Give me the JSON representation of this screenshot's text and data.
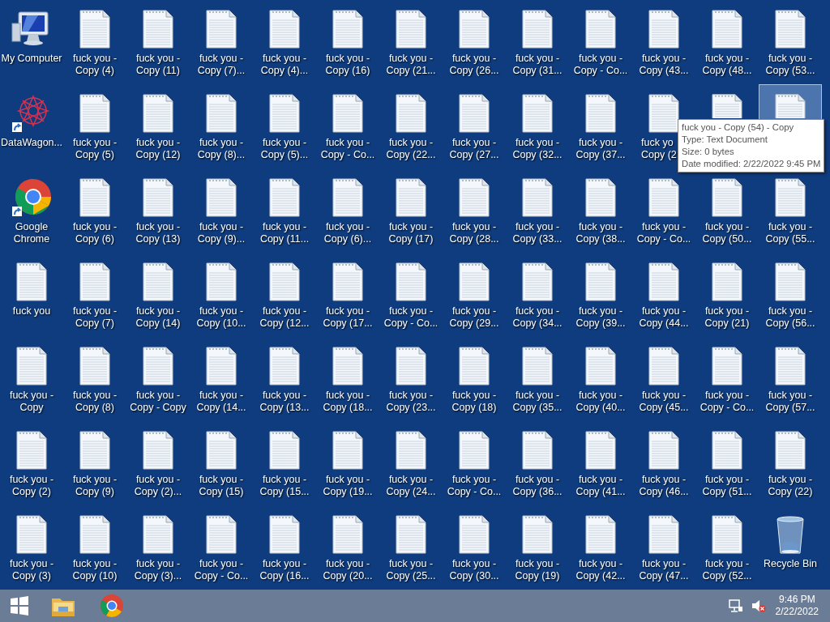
{
  "desktop_rows": [
    [
      {
        "kind": "computer",
        "lines": [
          "My Computer"
        ],
        "selected": false
      },
      {
        "kind": "text",
        "lines": [
          "fuck you -",
          "Copy (4)"
        ],
        "selected": false
      },
      {
        "kind": "text",
        "lines": [
          "fuck you -",
          "Copy (11)"
        ],
        "selected": false
      },
      {
        "kind": "text",
        "lines": [
          "fuck you -",
          "Copy (7)..."
        ],
        "selected": false
      },
      {
        "kind": "text",
        "lines": [
          "fuck you -",
          "Copy (4)..."
        ],
        "selected": false
      },
      {
        "kind": "text",
        "lines": [
          "fuck you -",
          "Copy (16)"
        ],
        "selected": false
      },
      {
        "kind": "text",
        "lines": [
          "fuck you -",
          "Copy (21..."
        ],
        "selected": false
      },
      {
        "kind": "text",
        "lines": [
          "fuck you -",
          "Copy (26..."
        ],
        "selected": false
      },
      {
        "kind": "text",
        "lines": [
          "fuck you -",
          "Copy (31..."
        ],
        "selected": false
      },
      {
        "kind": "text",
        "lines": [
          "fuck you -",
          "Copy - Co..."
        ],
        "selected": false
      },
      {
        "kind": "text",
        "lines": [
          "fuck you -",
          "Copy (43..."
        ],
        "selected": false
      },
      {
        "kind": "text",
        "lines": [
          "fuck you -",
          "Copy (48..."
        ],
        "selected": false
      },
      {
        "kind": "text",
        "lines": [
          "fuck you -",
          "Copy (53..."
        ],
        "selected": false
      }
    ],
    [
      {
        "kind": "app",
        "lines": [
          "DataWagon..."
        ],
        "selected": false
      },
      {
        "kind": "text",
        "lines": [
          "fuck you -",
          "Copy (5)"
        ],
        "selected": false
      },
      {
        "kind": "text",
        "lines": [
          "fuck you -",
          "Copy (12)"
        ],
        "selected": false
      },
      {
        "kind": "text",
        "lines": [
          "fuck you -",
          "Copy (8)..."
        ],
        "selected": false
      },
      {
        "kind": "text",
        "lines": [
          "fuck you -",
          "Copy (5)..."
        ],
        "selected": false
      },
      {
        "kind": "text",
        "lines": [
          "fuck you -",
          "Copy - Co..."
        ],
        "selected": false
      },
      {
        "kind": "text",
        "lines": [
          "fuck you -",
          "Copy (22..."
        ],
        "selected": false
      },
      {
        "kind": "text",
        "lines": [
          "fuck you -",
          "Copy (27..."
        ],
        "selected": false
      },
      {
        "kind": "text",
        "lines": [
          "fuck you -",
          "Copy (32..."
        ],
        "selected": false
      },
      {
        "kind": "text",
        "lines": [
          "fuck you -",
          "Copy (37..."
        ],
        "selected": false
      },
      {
        "kind": "text",
        "lines": [
          "fuck yo",
          "Copy (2"
        ],
        "selected": false
      },
      {
        "kind": "text",
        "selected": false
      },
      {
        "kind": "text",
        "selected": true
      }
    ],
    [
      {
        "kind": "chrome",
        "lines": [
          "Google",
          "Chrome"
        ],
        "selected": false
      },
      {
        "kind": "text",
        "lines": [
          "fuck you -",
          "Copy (6)"
        ],
        "selected": false
      },
      {
        "kind": "text",
        "lines": [
          "fuck you -",
          "Copy (13)"
        ],
        "selected": false
      },
      {
        "kind": "text",
        "lines": [
          "fuck you -",
          "Copy (9)..."
        ],
        "selected": false
      },
      {
        "kind": "text",
        "lines": [
          "fuck you -",
          "Copy (11..."
        ],
        "selected": false
      },
      {
        "kind": "text",
        "lines": [
          "fuck you -",
          "Copy (6)..."
        ],
        "selected": false
      },
      {
        "kind": "text",
        "lines": [
          "fuck you -",
          "Copy (17)"
        ],
        "selected": false
      },
      {
        "kind": "text",
        "lines": [
          "fuck you -",
          "Copy (28..."
        ],
        "selected": false
      },
      {
        "kind": "text",
        "lines": [
          "fuck you -",
          "Copy (33..."
        ],
        "selected": false
      },
      {
        "kind": "text",
        "lines": [
          "fuck you -",
          "Copy (38..."
        ],
        "selected": false
      },
      {
        "kind": "text",
        "lines": [
          "fuck you -",
          "Copy - Co..."
        ],
        "selected": false
      },
      {
        "kind": "text",
        "lines": [
          "fuck you -",
          "Copy (50..."
        ],
        "selected": false
      },
      {
        "kind": "text",
        "lines": [
          "fuck you -",
          "Copy (55..."
        ],
        "selected": false
      }
    ],
    [
      {
        "kind": "text",
        "lines": [
          "fuck you"
        ],
        "selected": false
      },
      {
        "kind": "text",
        "lines": [
          "fuck you -",
          "Copy (7)"
        ],
        "selected": false
      },
      {
        "kind": "text",
        "lines": [
          "fuck you -",
          "Copy (14)"
        ],
        "selected": false
      },
      {
        "kind": "text",
        "lines": [
          "fuck you -",
          "Copy (10..."
        ],
        "selected": false
      },
      {
        "kind": "text",
        "lines": [
          "fuck you -",
          "Copy (12..."
        ],
        "selected": false
      },
      {
        "kind": "text",
        "lines": [
          "fuck you -",
          "Copy (17..."
        ],
        "selected": false
      },
      {
        "kind": "text",
        "lines": [
          "fuck you -",
          "Copy - Co..."
        ],
        "selected": false
      },
      {
        "kind": "text",
        "lines": [
          "fuck you -",
          "Copy (29..."
        ],
        "selected": false
      },
      {
        "kind": "text",
        "lines": [
          "fuck you -",
          "Copy (34..."
        ],
        "selected": false
      },
      {
        "kind": "text",
        "lines": [
          "fuck you -",
          "Copy (39..."
        ],
        "selected": false
      },
      {
        "kind": "text",
        "lines": [
          "fuck you -",
          "Copy (44..."
        ],
        "selected": false
      },
      {
        "kind": "text",
        "lines": [
          "fuck you -",
          "Copy (21)"
        ],
        "selected": false
      },
      {
        "kind": "text",
        "lines": [
          "fuck you -",
          "Copy (56..."
        ],
        "selected": false
      }
    ],
    [
      {
        "kind": "text",
        "lines": [
          "fuck you -",
          "Copy"
        ],
        "selected": false
      },
      {
        "kind": "text",
        "lines": [
          "fuck you -",
          "Copy (8)"
        ],
        "selected": false
      },
      {
        "kind": "text",
        "lines": [
          "fuck you -",
          "Copy - Copy"
        ],
        "selected": false
      },
      {
        "kind": "text",
        "lines": [
          "fuck you -",
          "Copy (14..."
        ],
        "selected": false
      },
      {
        "kind": "text",
        "lines": [
          "fuck you -",
          "Copy (13..."
        ],
        "selected": false
      },
      {
        "kind": "text",
        "lines": [
          "fuck you -",
          "Copy (18..."
        ],
        "selected": false
      },
      {
        "kind": "text",
        "lines": [
          "fuck you -",
          "Copy (23..."
        ],
        "selected": false
      },
      {
        "kind": "text",
        "lines": [
          "fuck you -",
          "Copy (18)"
        ],
        "selected": false
      },
      {
        "kind": "text",
        "lines": [
          "fuck you -",
          "Copy (35..."
        ],
        "selected": false
      },
      {
        "kind": "text",
        "lines": [
          "fuck you -",
          "Copy (40..."
        ],
        "selected": false
      },
      {
        "kind": "text",
        "lines": [
          "fuck you -",
          "Copy (45..."
        ],
        "selected": false
      },
      {
        "kind": "text",
        "lines": [
          "fuck you -",
          "Copy - Co..."
        ],
        "selected": false
      },
      {
        "kind": "text",
        "lines": [
          "fuck you -",
          "Copy (57..."
        ],
        "selected": false
      }
    ],
    [
      {
        "kind": "text",
        "lines": [
          "fuck you -",
          "Copy (2)"
        ],
        "selected": false
      },
      {
        "kind": "text",
        "lines": [
          "fuck you -",
          "Copy (9)"
        ],
        "selected": false
      },
      {
        "kind": "text",
        "lines": [
          "fuck you -",
          "Copy (2)..."
        ],
        "selected": false
      },
      {
        "kind": "text",
        "lines": [
          "fuck you -",
          "Copy (15)"
        ],
        "selected": false
      },
      {
        "kind": "text",
        "lines": [
          "fuck you -",
          "Copy (15..."
        ],
        "selected": false
      },
      {
        "kind": "text",
        "lines": [
          "fuck you -",
          "Copy (19..."
        ],
        "selected": false
      },
      {
        "kind": "text",
        "lines": [
          "fuck you -",
          "Copy (24..."
        ],
        "selected": false
      },
      {
        "kind": "text",
        "lines": [
          "fuck you -",
          "Copy - Co..."
        ],
        "selected": false
      },
      {
        "kind": "text",
        "lines": [
          "fuck you -",
          "Copy (36..."
        ],
        "selected": false
      },
      {
        "kind": "text",
        "lines": [
          "fuck you -",
          "Copy (41..."
        ],
        "selected": false
      },
      {
        "kind": "text",
        "lines": [
          "fuck you -",
          "Copy (46..."
        ],
        "selected": false
      },
      {
        "kind": "text",
        "lines": [
          "fuck you -",
          "Copy (51..."
        ],
        "selected": false
      },
      {
        "kind": "text",
        "lines": [
          "fuck you -",
          "Copy (22)"
        ],
        "selected": false
      }
    ],
    [
      {
        "kind": "text",
        "lines": [
          "fuck you -",
          "Copy (3)"
        ],
        "selected": false
      },
      {
        "kind": "text",
        "lines": [
          "fuck you -",
          "Copy (10)"
        ],
        "selected": false
      },
      {
        "kind": "text",
        "lines": [
          "fuck you -",
          "Copy (3)..."
        ],
        "selected": false
      },
      {
        "kind": "text",
        "lines": [
          "fuck you -",
          "Copy - Co..."
        ],
        "selected": false
      },
      {
        "kind": "text",
        "lines": [
          "fuck you -",
          "Copy (16..."
        ],
        "selected": false
      },
      {
        "kind": "text",
        "lines": [
          "fuck you -",
          "Copy (20..."
        ],
        "selected": false
      },
      {
        "kind": "text",
        "lines": [
          "fuck you -",
          "Copy (25..."
        ],
        "selected": false
      },
      {
        "kind": "text",
        "lines": [
          "fuck you -",
          "Copy (30..."
        ],
        "selected": false
      },
      {
        "kind": "text",
        "lines": [
          "fuck you -",
          "Copy (19)"
        ],
        "selected": false
      },
      {
        "kind": "text",
        "lines": [
          "fuck you -",
          "Copy (42..."
        ],
        "selected": false
      },
      {
        "kind": "text",
        "lines": [
          "fuck you -",
          "Copy (47..."
        ],
        "selected": false
      },
      {
        "kind": "text",
        "lines": [
          "fuck you -",
          "Copy (52..."
        ],
        "selected": false
      },
      {
        "kind": "recycle",
        "lines": [
          "Recycle Bin"
        ],
        "selected": false
      }
    ]
  ],
  "tooltip": {
    "lines": [
      "fuck you - Copy (54) - Copy",
      "Type: Text Document",
      "Size: 0 bytes",
      "Date modified: 2/22/2022 9:45 PM"
    ]
  },
  "taskbar": {
    "apps": [
      {
        "kind": "start"
      },
      {
        "kind": "explorer"
      },
      {
        "kind": "chrome"
      }
    ],
    "tray": {
      "muted": true,
      "time": "9:46 PM",
      "date": "2/22/2022"
    }
  }
}
